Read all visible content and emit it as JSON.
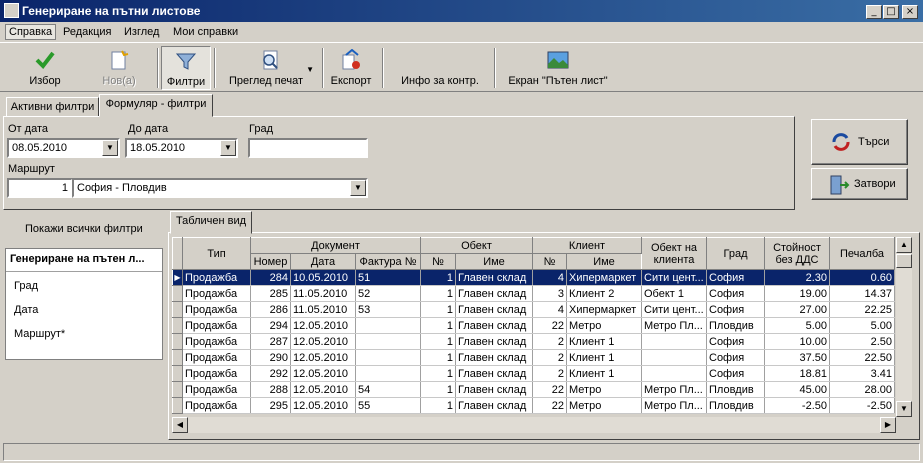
{
  "window": {
    "title": "Генериране на пътни листове",
    "minimize": "_",
    "maximize": "□",
    "close": "×"
  },
  "menu": [
    "Справка",
    "Редакция",
    "Изглед",
    "Мои справки"
  ],
  "toolbar": {
    "choose": "Избор",
    "new": "Нов(а)",
    "filters": "Филтри",
    "print_preview": "Преглед печат",
    "export": "Експорт",
    "info": "Инфо за контр.",
    "screen": "Екран \"Пътен лист\""
  },
  "filter_tabs": [
    "Активни филтри",
    "Формуляр - филтри"
  ],
  "form": {
    "from_date_label": "От дата",
    "from_date": "08.05.2010",
    "to_date_label": "До дата",
    "to_date": "18.05.2010",
    "city_label": "Град",
    "city": "",
    "route_label": "Маршрут",
    "route_no": "1",
    "route_name": "София - Пловдив"
  },
  "buttons": {
    "search": "Търси",
    "close": "Затвори"
  },
  "left_panel": {
    "show_all": "Покажи всички филтри",
    "header": "Генериране на пътен л...",
    "items": [
      "Град",
      "Дата",
      "Маршрут*"
    ]
  },
  "grid_tab": "Табличен вид",
  "grid": {
    "groups": {
      "type": "Тип",
      "document": "Документ",
      "object": "Обект",
      "client": "Клиент",
      "client_object": "Обект на клиента",
      "city": "Град",
      "value": "Стойност без ДДС",
      "profit": "Печалба"
    },
    "sub": {
      "number": "Номер",
      "date": "Дата",
      "invoice": "Фактура №",
      "obj_no": "№",
      "obj_name": "Име",
      "cl_no": "№",
      "cl_name": "Име"
    },
    "rows": [
      [
        "Продажба",
        "284",
        "10.05.2010",
        "51",
        "1",
        "Главен склад",
        "4",
        "Хипермаркет",
        "Сити цент...",
        "София",
        "2.30",
        "0.60"
      ],
      [
        "Продажба",
        "285",
        "11.05.2010",
        "52",
        "1",
        "Главен склад",
        "3",
        "Клиент 2",
        "Обект 1",
        "София",
        "19.00",
        "14.37"
      ],
      [
        "Продажба",
        "286",
        "11.05.2010",
        "53",
        "1",
        "Главен склад",
        "4",
        "Хипермаркет",
        "Сити цент...",
        "София",
        "27.00",
        "22.25"
      ],
      [
        "Продажба",
        "294",
        "12.05.2010",
        "",
        "1",
        "Главен склад",
        "22",
        "Метро",
        "Метро Пл...",
        "Пловдив",
        "5.00",
        "5.00"
      ],
      [
        "Продажба",
        "287",
        "12.05.2010",
        "",
        "1",
        "Главен склад",
        "2",
        "Клиент 1",
        "",
        "София",
        "10.00",
        "2.50"
      ],
      [
        "Продажба",
        "290",
        "12.05.2010",
        "",
        "1",
        "Главен склад",
        "2",
        "Клиент 1",
        "",
        "София",
        "37.50",
        "22.50"
      ],
      [
        "Продажба",
        "292",
        "12.05.2010",
        "",
        "1",
        "Главен склад",
        "2",
        "Клиент 1",
        "",
        "София",
        "18.81",
        "3.41"
      ],
      [
        "Продажба",
        "288",
        "12.05.2010",
        "54",
        "1",
        "Главен склад",
        "22",
        "Метро",
        "Метро Пл...",
        "Пловдив",
        "45.00",
        "28.00"
      ],
      [
        "Продажба",
        "295",
        "12.05.2010",
        "55",
        "1",
        "Главен склад",
        "22",
        "Метро",
        "Метро Пл...",
        "Пловдив",
        "-2.50",
        "-2.50"
      ]
    ],
    "selected_row": 0
  },
  "icons": {
    "choose": "checkmark-icon",
    "new": "new-document-icon",
    "filters": "funnel-icon",
    "print_preview": "magnifier-page-icon",
    "export": "export-icon",
    "screen": "landscape-picture-icon",
    "search": "refresh-search-icon",
    "close": "door-exit-icon"
  }
}
